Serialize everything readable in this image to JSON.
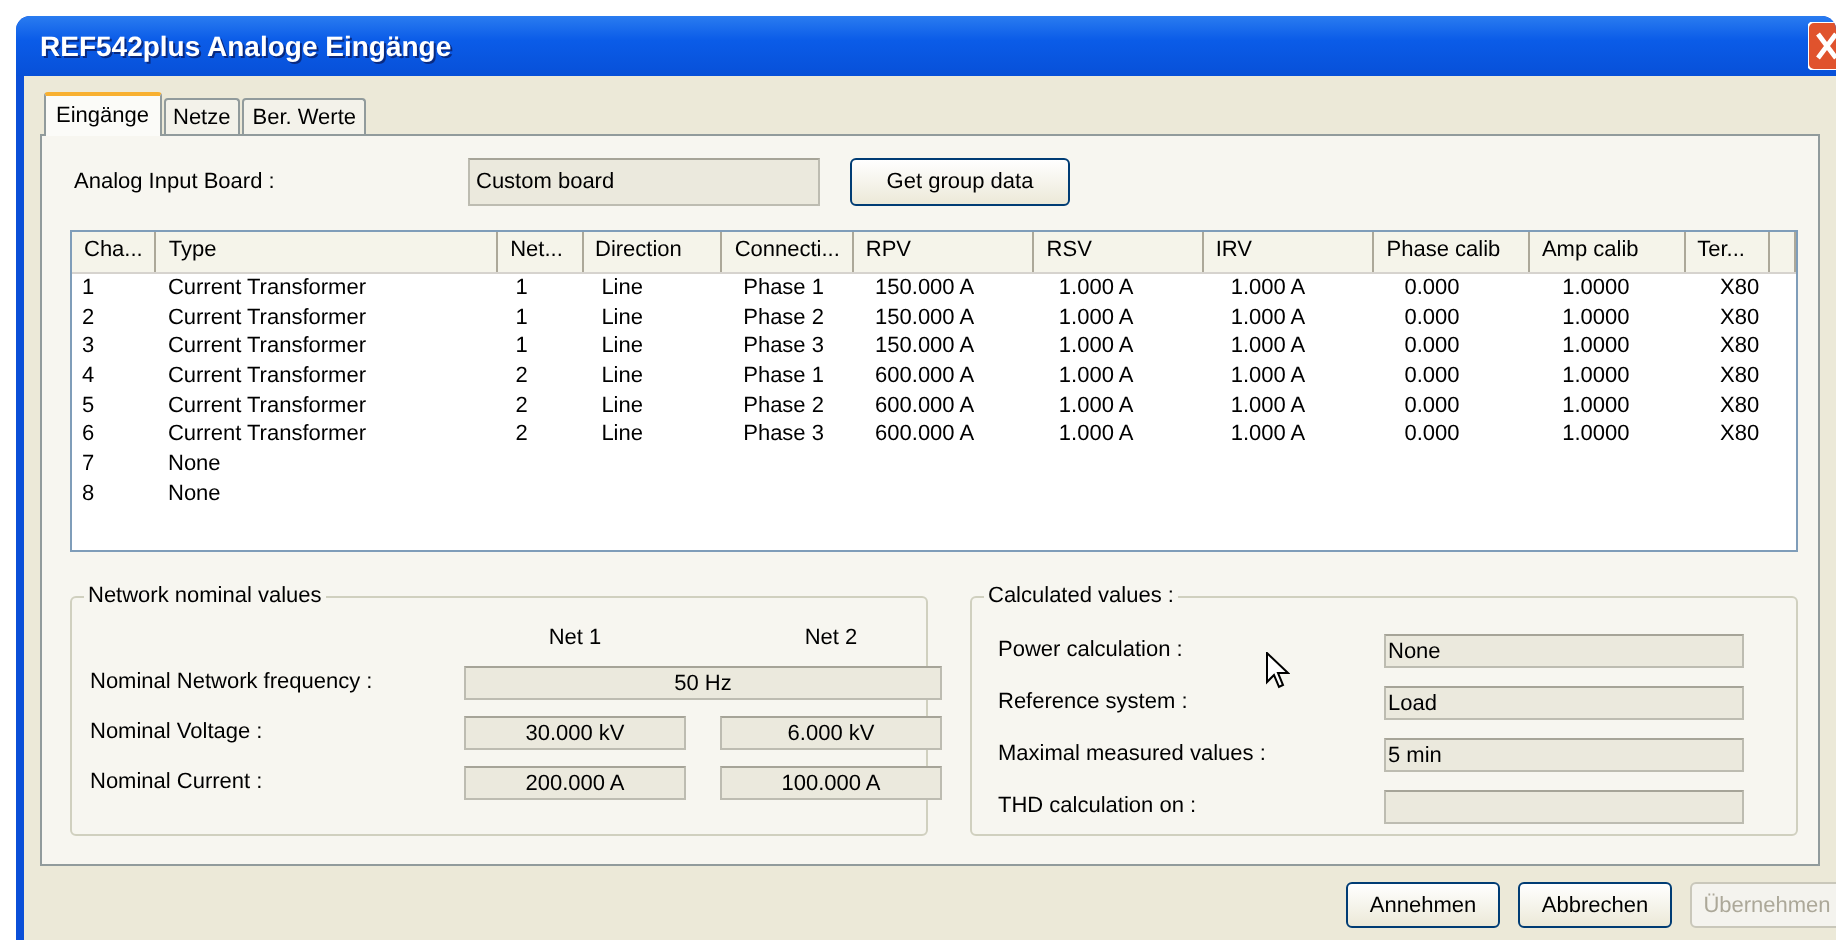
{
  "window": {
    "title": "REF542plus Analoge Eingänge"
  },
  "tabs": [
    {
      "label": "Eingänge",
      "selected": true
    },
    {
      "label": "Netze",
      "selected": false
    },
    {
      "label": "Ber. Werte",
      "selected": false
    }
  ],
  "board": {
    "label": "Analog Input Board :",
    "value": "Custom board",
    "button": "Get group data"
  },
  "table": {
    "columns": [
      "Cha...",
      "Type",
      "Net...",
      "Direction",
      "Connecti...",
      "RPV",
      "RSV",
      "IRV",
      "Phase calib",
      "Amp calib",
      "Ter..."
    ],
    "rows": [
      [
        "1",
        "Current Transformer",
        "1",
        "Line",
        "Phase 1",
        "150.000 A",
        "1.000 A",
        "1.000 A",
        "0.000",
        "1.0000",
        "X80"
      ],
      [
        "2",
        "Current Transformer",
        "1",
        "Line",
        "Phase 2",
        "150.000 A",
        "1.000 A",
        "1.000 A",
        "0.000",
        "1.0000",
        "X80"
      ],
      [
        "3",
        "Current Transformer",
        "1",
        "Line",
        "Phase 3",
        "150.000 A",
        "1.000 A",
        "1.000 A",
        "0.000",
        "1.0000",
        "X80"
      ],
      [
        "4",
        "Current Transformer",
        "2",
        "Line",
        "Phase 1",
        "600.000 A",
        "1.000 A",
        "1.000 A",
        "0.000",
        "1.0000",
        "X80"
      ],
      [
        "5",
        "Current Transformer",
        "2",
        "Line",
        "Phase 2",
        "600.000 A",
        "1.000 A",
        "1.000 A",
        "0.000",
        "1.0000",
        "X80"
      ],
      [
        "6",
        "Current Transformer",
        "2",
        "Line",
        "Phase 3",
        "600.000 A",
        "1.000 A",
        "1.000 A",
        "0.000",
        "1.0000",
        "X80"
      ],
      [
        "7",
        "None"
      ],
      [
        "8",
        "None"
      ]
    ]
  },
  "network": {
    "title": "Network nominal values",
    "columns": [
      "Net 1",
      "Net 2"
    ],
    "rows": [
      {
        "label": "Nominal Network frequency :",
        "values": [
          "50 Hz"
        ]
      },
      {
        "label": "Nominal Voltage :",
        "values": [
          "30.000 kV",
          "6.000 kV"
        ]
      },
      {
        "label": "Nominal Current :",
        "values": [
          "200.000 A",
          "100.000 A"
        ]
      }
    ]
  },
  "calculated": {
    "title": "Calculated values :",
    "rows": [
      {
        "label": "Power calculation :",
        "value": "None"
      },
      {
        "label": "Reference system :",
        "value": "Load"
      },
      {
        "label": "Maximal measured values :",
        "value": "5 min"
      },
      {
        "label": "THD calculation on :"
      }
    ]
  },
  "buttons": [
    {
      "label": "Annehmen",
      "disabled": false
    },
    {
      "label": "Abbrechen",
      "disabled": false
    },
    {
      "label": "Übernehmen",
      "disabled": true
    }
  ]
}
